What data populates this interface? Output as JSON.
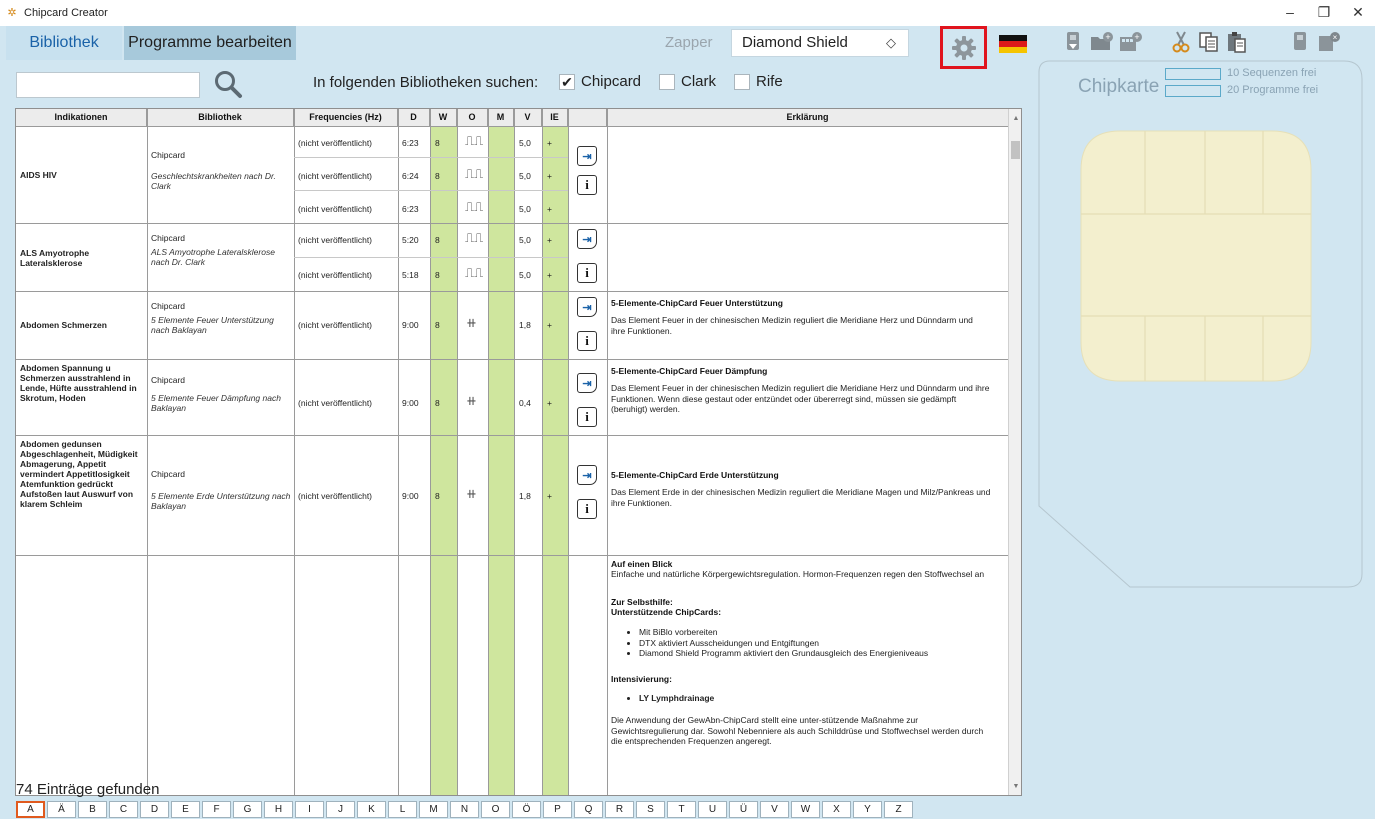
{
  "window": {
    "title": "Chipcard Creator",
    "controls": [
      "–",
      "❐",
      "✕"
    ]
  },
  "tabs": [
    {
      "label": "Bibliothek",
      "active": true
    },
    {
      "label": "Programme bearbeiten",
      "active": false
    }
  ],
  "zapper": {
    "label": "Zapper",
    "selected": "Diamond Shield"
  },
  "search": {
    "value": "",
    "hint": "In folgenden Bibliotheken suchen:",
    "filters": [
      {
        "label": "Chipcard",
        "checked": true
      },
      {
        "label": "Clark",
        "checked": false
      },
      {
        "label": "Rife",
        "checked": false
      }
    ]
  },
  "table": {
    "headers": [
      "Indikationen",
      "Bibliothek",
      "Frequencies (Hz)",
      "D",
      "W",
      "O",
      "M",
      "V",
      "IE",
      "",
      "Erklärung"
    ],
    "rows": [
      {
        "indication": "AIDS HIV",
        "library": "Chipcard",
        "library_sub": "Geschlechtskrankheiten nach Dr. Clark",
        "subrows": [
          {
            "freq": "(nicht veröffentlicht)",
            "d": "6:23",
            "w": "8",
            "v": "5,0",
            "ie": "+"
          },
          {
            "freq": "(nicht veröffentlicht)",
            "d": "6:24",
            "w": "8",
            "v": "5,0",
            "ie": "+"
          },
          {
            "freq": "(nicht veröffentlicht)",
            "d": "6:23",
            "w": "",
            "v": "5,0",
            "ie": "+"
          }
        ]
      },
      {
        "indication": "ALS Amyotrophe Lateralsklerose",
        "library": "Chipcard",
        "library_sub": "ALS Amyotrophe Lateralsklerose nach Dr. Clark",
        "subrows": [
          {
            "freq": "(nicht veröffentlicht)",
            "d": "5:20",
            "w": "8",
            "v": "5,0",
            "ie": "+"
          },
          {
            "freq": "(nicht veröffentlicht)",
            "d": "5:18",
            "w": "8",
            "v": "5,0",
            "ie": "+"
          }
        ]
      },
      {
        "indication": "Abdomen Schmerzen",
        "library": "Chipcard",
        "library_sub": "5 Elemente Feuer Unterstützung nach Baklayan",
        "freq": "(nicht veröffentlicht)",
        "d": "9:00",
        "w": "8",
        "v": "1,8",
        "ie": "+",
        "expl_title": "5-Elemente-ChipCard Feuer Unterstützung",
        "expl_text": "Das Element Feuer in der chinesischen Medizin reguliert die Meridiane Herz und Dünndarm und ihre Funktionen."
      },
      {
        "indication": "Abdomen Spannung u Schmerzen ausstrahlend in Lende, Hüfte ausstrahlend in Skrotum, Hoden",
        "library": "Chipcard",
        "library_sub": "5 Elemente Feuer Dämpfung nach Baklayan",
        "freq": "(nicht veröffentlicht)",
        "d": "9:00",
        "w": "8",
        "v": "0,4",
        "ie": "+",
        "expl_title": "5-Elemente-ChipCard Feuer Dämpfung",
        "expl_text": "Das Element Feuer in der chinesischen Medizin reguliert die Meridiane Herz und Dünndarm und ihre Funktionen. Wenn diese gestaut oder entzündet oder übererregt sind, müssen sie gedämpft (beruhigt) werden."
      },
      {
        "indication": "Abdomen gedunsen Abgeschlagenheit, Müdigkeit Abmagerung, Appetit vermindert Appetitlosigkeit Atemfunktion gedrückt Aufstoßen laut Auswurf von klarem Schleim",
        "library": "Chipcard",
        "library_sub": "5 Elemente Erde Unterstützung nach Baklayan",
        "freq": "(nicht veröffentlicht)",
        "d": "9:00",
        "w": "8",
        "v": "1,8",
        "ie": "+",
        "expl_title": "5-Elemente-ChipCard Erde Unterstützung",
        "expl_text": "Das Element Erde in der chinesischen Medizin reguliert die Meridiane Magen und Milz/Pankreas und ihre Funktionen."
      }
    ],
    "last_row_expl": {
      "title1": "Auf einen Blick",
      "text1": "Einfache und natürliche Körpergewichtsregulation. Hormon-Frequenzen regen den Stoffwechsel an",
      "title2": "Zur Selbsthilfe:",
      "title3": "Unterstützende ChipCards:",
      "bullets": [
        "Mit BiBlo vorbereiten",
        "DTX aktiviert Ausscheidungen und Entgiftungen",
        "Diamond Shield Programm aktiviert den Grundausgleich des Energieniveaus"
      ],
      "title4": "Intensivierung:",
      "bullet2": "LY Lymphdrainage",
      "text2": "Die Anwendung der GewAbn-ChipCard stellt eine unter-stützende Maßnahme zur Gewichtsregulierung dar. Sowohl Nebenniere als auch Schilddrüse und Stoffwechsel werden durch die entsprechenden Frequenzen angeregt."
    }
  },
  "result_count": "74 Einträge gefunden",
  "alphabet": [
    "A",
    "Ä",
    "B",
    "C",
    "D",
    "E",
    "F",
    "G",
    "H",
    "I",
    "J",
    "K",
    "L",
    "M",
    "N",
    "O",
    "Ö",
    "P",
    "Q",
    "R",
    "S",
    "T",
    "U",
    "Ü",
    "V",
    "W",
    "X",
    "Y",
    "Z"
  ],
  "active_letter": "A",
  "chip": {
    "label": "Chipkarte",
    "sequences_free": "10 Sequenzen frei",
    "programs_free": "20 Programme frei"
  },
  "colors": {
    "panel_bg": "#d1e6f1",
    "highlight_border": "#e0141e",
    "green_column": "#cfe69e",
    "active_tab_text": "#1a62a8"
  }
}
